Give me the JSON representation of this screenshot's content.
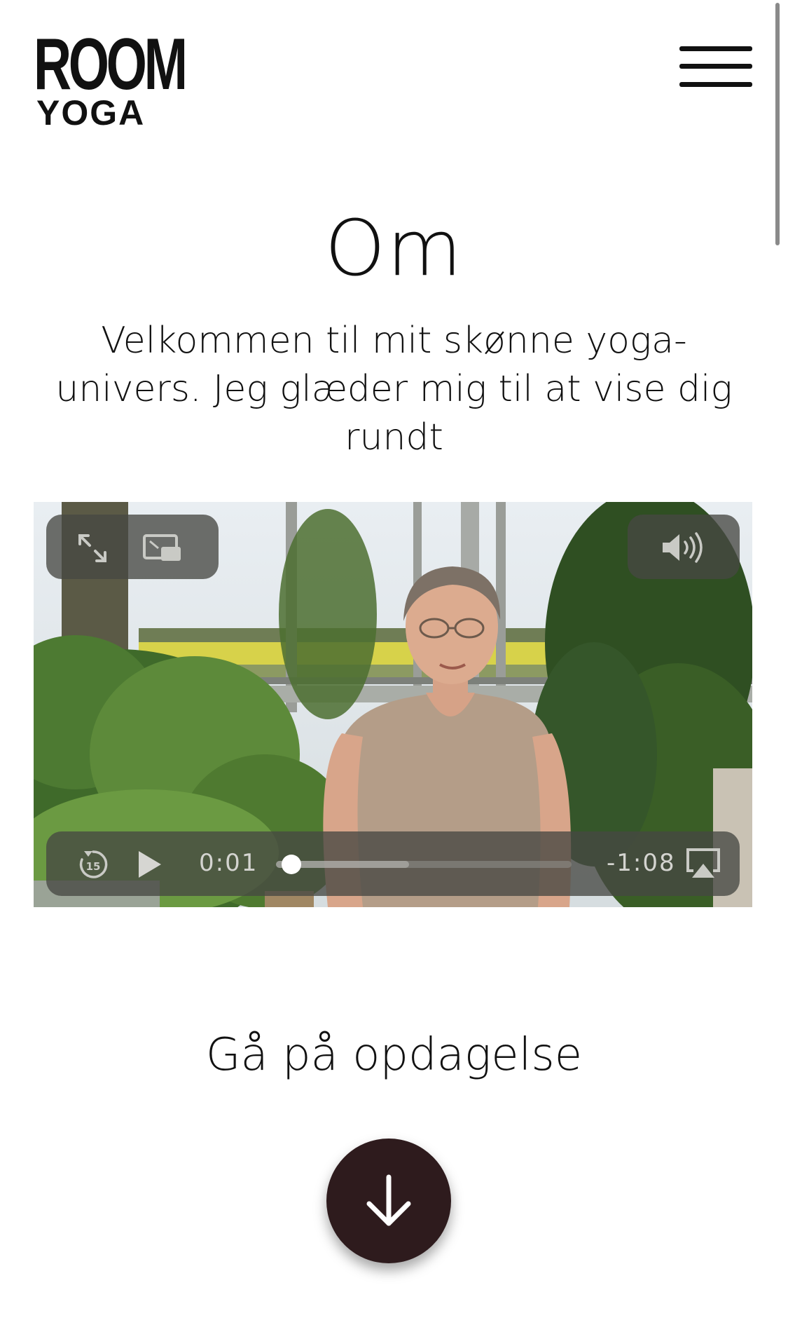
{
  "header": {
    "logo_line1": "ROOM",
    "logo_line2": "YOGA",
    "menu_icon": "hamburger-menu-icon"
  },
  "main": {
    "title": "Om",
    "intro": "Velkommen til mit skønne yoga-univers. Jeg glæder mig til at vise dig rundt",
    "discover_heading": "Gå på opdagelse",
    "discover_button_icon": "arrow-down-icon"
  },
  "video": {
    "current_time": "0:01",
    "remaining_time": "-1:08",
    "progress": 0.02,
    "buffered": 0.45,
    "controls": {
      "top_left": [
        "fullscreen-icon",
        "picture-in-picture-icon"
      ],
      "top_right": [
        "volume-icon"
      ],
      "bottom": [
        "rewind-15-icon",
        "play-icon",
        "airplay-icon"
      ]
    }
  },
  "colors": {
    "button_bg": "#2e1b1d",
    "text": "#111111",
    "control_pill": "#46483f"
  }
}
